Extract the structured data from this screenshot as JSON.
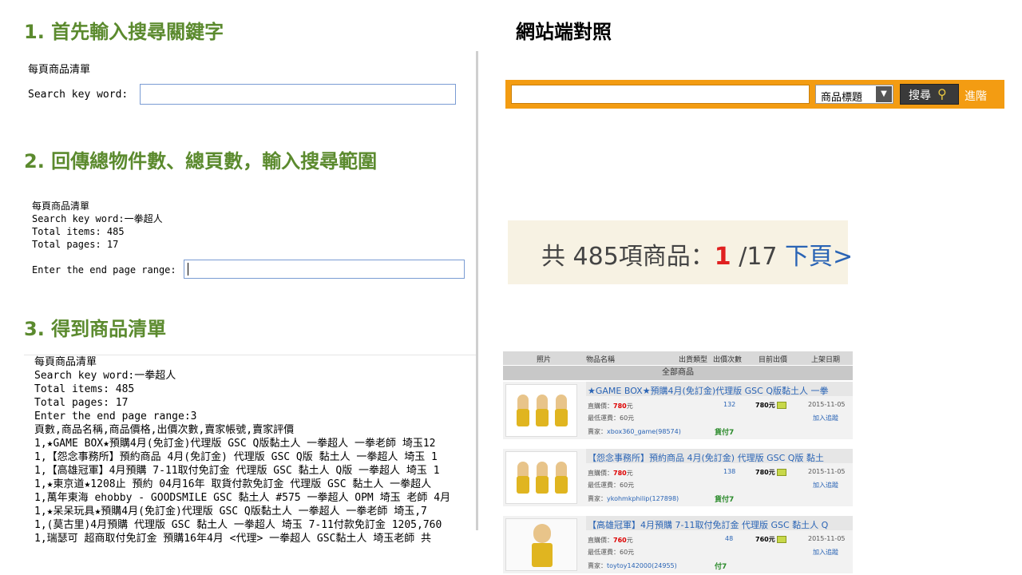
{
  "left": {
    "step1": {
      "heading": "1. 首先輸入搜尋關鍵字",
      "title": "每頁商品清單",
      "label": "Search key word:",
      "value": ""
    },
    "step2": {
      "heading": "2. 回傳總物件數、總頁數，輸入搜尋範圍",
      "lines": [
        "每頁商品清單",
        "Search key word:一拳超人",
        "Total items: 485",
        "Total pages: 17"
      ],
      "range_label": "Enter the end page range:",
      "range_value": ""
    },
    "step3": {
      "heading": "3. 得到商品清單",
      "lines": [
        "每頁商品清單",
        "Search key word:一拳超人",
        "Total items: 485",
        "Total pages: 17",
        "Enter the end page range:3",
        "頁數,商品名稱,商品價格,出價次數,賣家帳號,賣家評價",
        "1,★GAME BOX★預購4月(免訂金)代理版 GSC Q版黏土人 一拳超人 一拳老師 埼玉12",
        "1,【怨念事務所】預約商品 4月(免訂金) 代理版 GSC Q版 黏土人 一拳超人 埼玉 1",
        "1,【高雄冠軍】4月預購 7-11取付免訂金 代理版 GSC 黏土人 Q版 一拳超人 埼玉 1",
        "1,★東京道★1208止 預約 04月16年 取貨付款免訂金 代理版 GSC 黏土人 一拳超人",
        "1,萬年東海 ehobby - GOODSMILE GSC 黏土人 #575 一拳超人 OPM 埼玉 老師 4月",
        "1,★呆呆玩具★預購4月(免訂金)代理版 GSC Q版黏土人 一拳超人 一拳老師 埼玉,7",
        "1,(莫古里)4月預購 代理版 GSC 黏土人 一拳超人 埼玉 7-11付款免訂金 1205,760",
        "1,瑞瑟可 超商取付免訂金 預購16年4月 <代理> 一拳超人 GSC黏土人 埼玉老師 共"
      ]
    }
  },
  "right": {
    "heading": "網站端對照",
    "search": {
      "input_value": "",
      "select_value": "商品標題",
      "button_label": "搜尋",
      "advanced_link": "進階"
    },
    "totals": {
      "prefix": "共 485項商品：",
      "current_page": "1",
      "total_pages": " /17 ",
      "next_link": "下頁>"
    },
    "listing": {
      "columns": [
        "照片",
        "物品名稱",
        "出貨類型",
        "出價次數",
        "目前出價",
        "上架日期"
      ],
      "section_label": "全部商品",
      "items": [
        {
          "title": "★GAME BOX★預購4月(免訂金)代理版 GSC Q版黏土人 一拳",
          "direct_label": "直購價：",
          "direct_price": "780",
          "direct_unit": "元",
          "shipping": "最低運費：60元",
          "seller_label": "賣家：",
          "seller": "xbox360_game(98574)",
          "bids": "132",
          "current_price": "780元",
          "date": "2015-11-05",
          "track": "加入追蹤",
          "pay": "貨付7"
        },
        {
          "title": "【怨念事務所】預約商品 4月(免訂金) 代理版 GSC Q版 黏土",
          "direct_label": "直購價：",
          "direct_price": "780",
          "direct_unit": "元",
          "shipping": "最低運費：60元",
          "seller_label": "賣家：",
          "seller": "ykohmkphilip(127898)",
          "bids": "138",
          "current_price": "780元",
          "date": "2015-11-05",
          "track": "加入追蹤",
          "pay": "貨付7"
        },
        {
          "title": "【高雄冠軍】4月預購 7-11取付免訂金 代理版 GSC 黏土人 Q",
          "direct_label": "直購價：",
          "direct_price": "760",
          "direct_unit": "元",
          "shipping": "最低運費：60元",
          "seller_label": "賣家：",
          "seller": "toytoy142000(24955)",
          "bids": "48",
          "current_price": "760元",
          "date": "2015-11-05",
          "track": "加入追蹤",
          "pay": "付7"
        }
      ]
    }
  }
}
